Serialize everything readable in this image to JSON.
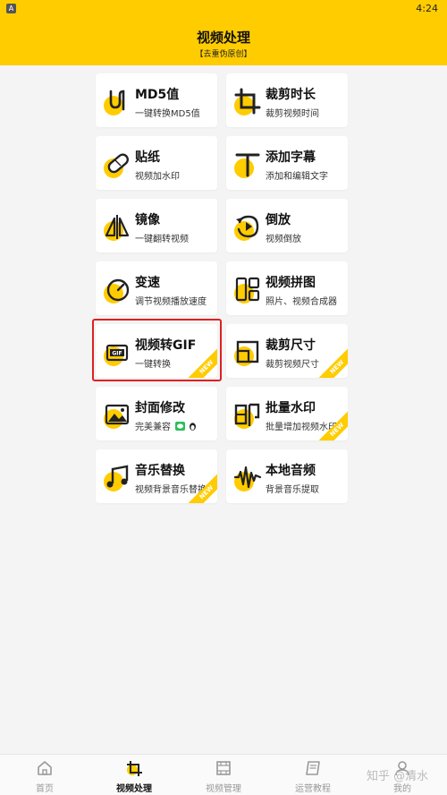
{
  "status_bar": {
    "app_icon_label": "A",
    "time": "4:24"
  },
  "header": {
    "title": "视频处理",
    "subtitle": "【去重伪原创】"
  },
  "tools": [
    {
      "title": "MD5值",
      "subtitle": "一键转换MD5值",
      "icon": "md5-icon",
      "new": false
    },
    {
      "title": "裁剪时长",
      "subtitle": "裁剪视频时间",
      "icon": "crop-duration-icon",
      "new": false
    },
    {
      "title": "贴纸",
      "subtitle": "视频加水印",
      "icon": "sticker-icon",
      "new": false
    },
    {
      "title": "添加字幕",
      "subtitle": "添加和编辑文字",
      "icon": "text-icon",
      "new": false
    },
    {
      "title": "镜像",
      "subtitle": "一键翻转视频",
      "icon": "mirror-icon",
      "new": false
    },
    {
      "title": "倒放",
      "subtitle": "视频倒放",
      "icon": "reverse-play-icon",
      "new": false
    },
    {
      "title": "变速",
      "subtitle": "调节视频播放速度",
      "icon": "speed-icon",
      "new": false
    },
    {
      "title": "视频拼图",
      "subtitle": "照片、视频合成器",
      "icon": "collage-icon",
      "new": false
    },
    {
      "title": "视频转GIF",
      "subtitle": "一键转换",
      "icon": "gif-icon",
      "new": true
    },
    {
      "title": "裁剪尺寸",
      "subtitle": "裁剪视频尺寸",
      "icon": "crop-size-icon",
      "new": true
    },
    {
      "title": "封面修改",
      "subtitle": "完美兼容",
      "icon": "cover-image-icon",
      "new": false
    },
    {
      "title": "批量水印",
      "subtitle": "批量增加视频水印",
      "icon": "batch-watermark-icon",
      "new": true
    },
    {
      "title": "音乐替换",
      "subtitle": "视频背景音乐替换",
      "icon": "music-note-icon",
      "new": true
    },
    {
      "title": "本地音频",
      "subtitle": "背景音乐提取",
      "icon": "waveform-icon",
      "new": false
    }
  ],
  "badge_label": "NEW",
  "highlighted_tool": "视频转GIF",
  "tabs": [
    {
      "label": "首页",
      "icon": "home-icon",
      "active": false
    },
    {
      "label": "视频处理",
      "icon": "video-process-icon",
      "active": true
    },
    {
      "label": "视频管理",
      "icon": "film-icon",
      "active": false
    },
    {
      "label": "运营教程",
      "icon": "book-icon",
      "active": false
    },
    {
      "label": "我的",
      "icon": "profile-icon",
      "active": false
    }
  ],
  "watermark": "知乎 @清水",
  "colors": {
    "accent": "#ffcc00",
    "highlight_border": "#e02020",
    "background": "#f4f4f4"
  }
}
